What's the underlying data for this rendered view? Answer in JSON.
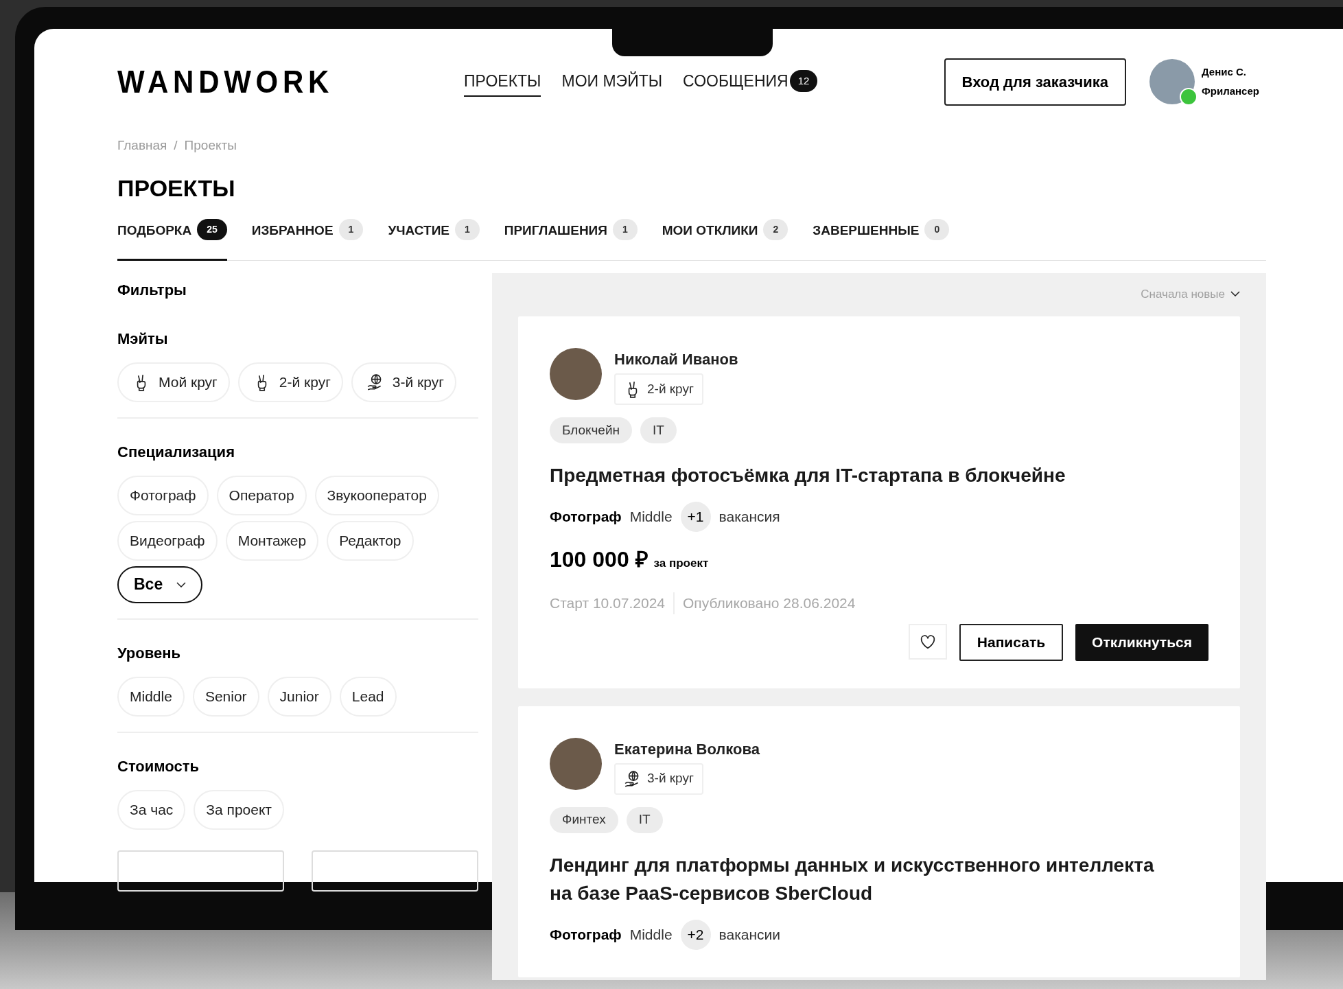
{
  "header": {
    "logo": "WANDWORK",
    "nav": [
      {
        "label": "ПРОЕКТЫ",
        "selected": true
      },
      {
        "label": "МОИ МЭЙТЫ",
        "selected": false
      },
      {
        "label": "СООБЩЕНИЯ",
        "selected": false,
        "badge": "12"
      }
    ],
    "login_button": "Вход для заказчика",
    "user": {
      "name": "Денис С.",
      "role": "Фрилансер",
      "online": true
    }
  },
  "breadcrumbs": [
    "Главная",
    "Проекты"
  ],
  "breadcrumb_separator": "/",
  "page_title": "ПРОЕКТЫ",
  "tabs": [
    {
      "label": "ПОДБОРКА",
      "count": "25",
      "selected": true
    },
    {
      "label": "ИЗБРАННОЕ",
      "count": "1",
      "selected": false
    },
    {
      "label": "УЧАСТИЕ",
      "count": "1",
      "selected": false
    },
    {
      "label": "ПРИГЛАШЕНИЯ",
      "count": "1",
      "selected": false
    },
    {
      "label": "МОИ ОТКЛИКИ",
      "count": "2",
      "selected": false
    },
    {
      "label": "ЗАВЕРШЕННЫЕ",
      "count": "0",
      "selected": false
    }
  ],
  "filters": {
    "title": "Фильтры",
    "groups": [
      {
        "title": "Мэйты",
        "chips": [
          {
            "label": "Мой круг",
            "kind": "hand"
          },
          {
            "label": "2-й круг",
            "kind": "hand"
          },
          {
            "label": "3-й круг",
            "kind": "globe"
          }
        ]
      },
      {
        "title": "Специализация",
        "chips": [
          {
            "label": "Фотограф",
            "kind": "plain"
          },
          {
            "label": "Оператор",
            "kind": "plain"
          },
          {
            "label": "Звукооператор",
            "kind": "plain"
          },
          {
            "label": "Видеограф",
            "kind": "plain"
          },
          {
            "label": "Монтажер",
            "kind": "plain"
          },
          {
            "label": "Редактор",
            "kind": "plain"
          },
          {
            "label": "Все",
            "kind": "dropdown"
          }
        ]
      },
      {
        "title": "Уровень",
        "chips": [
          {
            "label": "Middle",
            "kind": "plain"
          },
          {
            "label": "Senior",
            "kind": "plain"
          },
          {
            "label": "Junior",
            "kind": "plain"
          },
          {
            "label": "Lead",
            "kind": "plain"
          }
        ]
      },
      {
        "title": "Стоимость",
        "chips": [
          {
            "label": "За час",
            "kind": "plain"
          },
          {
            "label": "За проект",
            "kind": "plain"
          }
        ]
      }
    ]
  },
  "sort": "Сначала новые",
  "projects": [
    {
      "author": "Николай Иванов",
      "circle": {
        "label": "2-й круг",
        "kind": "hand"
      },
      "tags": [
        "Блокчейн",
        "IT"
      ],
      "title": "Предметная фотосъёмка для IT-стартапа в блокчейне",
      "role": "Фотограф",
      "level": "Middle",
      "extra": "+1",
      "vacancy_word": "вакансия",
      "price": "100 000 ₽",
      "price_unit": "за проект",
      "start": "Старт 10.07.2024",
      "published": "Опубликовано 28.06.2024",
      "favorite": false,
      "write_button": "Написать",
      "respond_button": "Откликнуться"
    },
    {
      "author": "Екатерина Волкова",
      "circle": {
        "label": "3-й круг",
        "kind": "globe"
      },
      "tags": [
        "Финтех",
        "IT"
      ],
      "title": "Лендинг для платформы данных и искусственного интеллекта на базе PaaS-сервисов SberCloud",
      "role": "Фотограф",
      "level": "Middle",
      "extra": "+2",
      "vacancy_word": "вакансии"
    }
  ]
}
